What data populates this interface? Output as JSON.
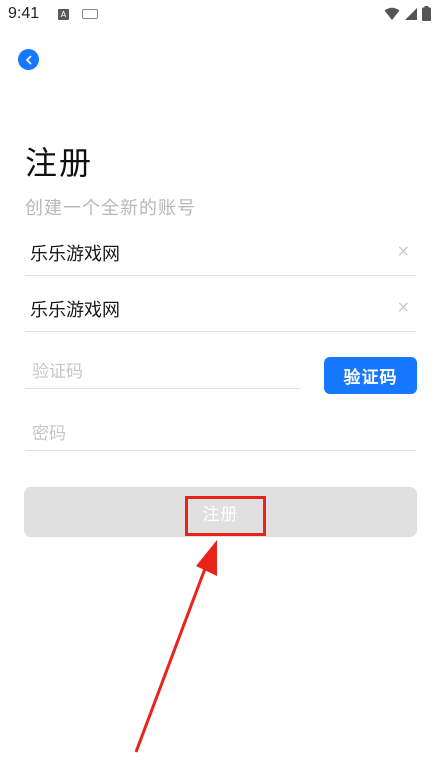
{
  "status_bar": {
    "time": "9:41",
    "icons": [
      "a-icon",
      "keyboard-icon",
      "wifi-icon",
      "signal-icon",
      "battery-icon"
    ]
  },
  "nav": {
    "back_icon": "chevron-left-icon"
  },
  "header": {
    "title": "注册",
    "subtitle": "创建一个全新的账号"
  },
  "form": {
    "field1": {
      "value": "乐乐游戏网",
      "clear": "×"
    },
    "field2": {
      "value": "乐乐游戏网",
      "clear": "×"
    },
    "code": {
      "placeholder": "验证码",
      "button_label": "验证码"
    },
    "password": {
      "placeholder": "密码"
    },
    "submit_label": "注册"
  },
  "colors": {
    "accent": "#1677ff",
    "annotation": "#e8241a",
    "disabled": "#e0e0e0"
  }
}
